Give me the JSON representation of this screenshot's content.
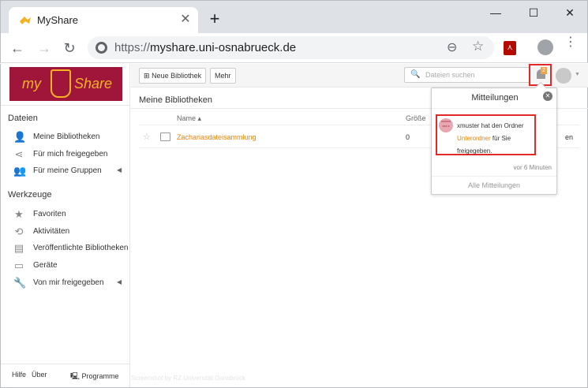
{
  "browser": {
    "tab_title": "MyShare",
    "tab_close": "✕",
    "new_tab": "+",
    "window": {
      "minimize": "—",
      "maximize": "☐",
      "close": "✕"
    },
    "nav": {
      "back": "←",
      "forward": "→",
      "reload": "↻"
    },
    "url_protocol": "https://",
    "url_host": "myshare.uni-osnabrueck.de",
    "zoom_icon": "⊖",
    "star_icon": "☆",
    "pdf_ext": "⋏",
    "kebab": "⋮"
  },
  "logo": {
    "part1": "my",
    "part2": "Share"
  },
  "sidebar": {
    "section_files": "Dateien",
    "files_items": [
      {
        "label": "Meine Bibliotheken",
        "icon": "user-icon",
        "glyph": "👤"
      },
      {
        "label": "Für mich freigegeben",
        "icon": "share-icon",
        "glyph": "⋖"
      },
      {
        "label": "Für meine Gruppen",
        "icon": "group-icon",
        "glyph": "👥",
        "arrow": "◀"
      }
    ],
    "section_tools": "Werkzeuge",
    "tools_items": [
      {
        "label": "Favoriten",
        "icon": "star-icon",
        "glyph": "★"
      },
      {
        "label": "Aktivitäten",
        "icon": "history-icon",
        "glyph": "⟲"
      },
      {
        "label": "Veröffentlichte Bibliotheken",
        "icon": "published-icon",
        "glyph": "▤"
      },
      {
        "label": "Geräte",
        "icon": "monitor-icon",
        "glyph": "▭"
      },
      {
        "label": "Von mir freigegeben",
        "icon": "wrench-icon",
        "glyph": "🔧",
        "arrow": "◀"
      }
    ],
    "footer": {
      "help": "Hilfe",
      "about": "Über",
      "programs": "🖳 Programme"
    }
  },
  "toolbar": {
    "new_library": "Neue Bibliothek",
    "new_library_icon": "⊞",
    "more": "Mehr",
    "search_placeholder": "Dateien suchen",
    "search_icon": "🔍",
    "notification_count": "2",
    "avatar_caret": "▼"
  },
  "main": {
    "title": "Meine Bibliotheken",
    "columns": {
      "name": "Name ▴",
      "size": "Größe"
    },
    "rows": [
      {
        "star": "☆",
        "name": "Zachariasdateisammlung",
        "size": "0",
        "trailing": "en"
      }
    ]
  },
  "popup": {
    "title": "Mitteilungen",
    "close": "✕",
    "notification": {
      "avatar_text": "xxxxxx xxx x",
      "text_before": "xmuster hat den Ordner ",
      "link": "Unterordner",
      "text_after": " für Sie freigegeben.",
      "time": "vor 6 Minuten"
    },
    "footer": "Alle Mitteilungen"
  },
  "watermark": "Screenshot by RZ Universität Osnabrück",
  "colors": {
    "brand": "#a0163b",
    "accent": "#eb8205",
    "highlight": "#e12a26",
    "logo_text": "#f5b324"
  }
}
